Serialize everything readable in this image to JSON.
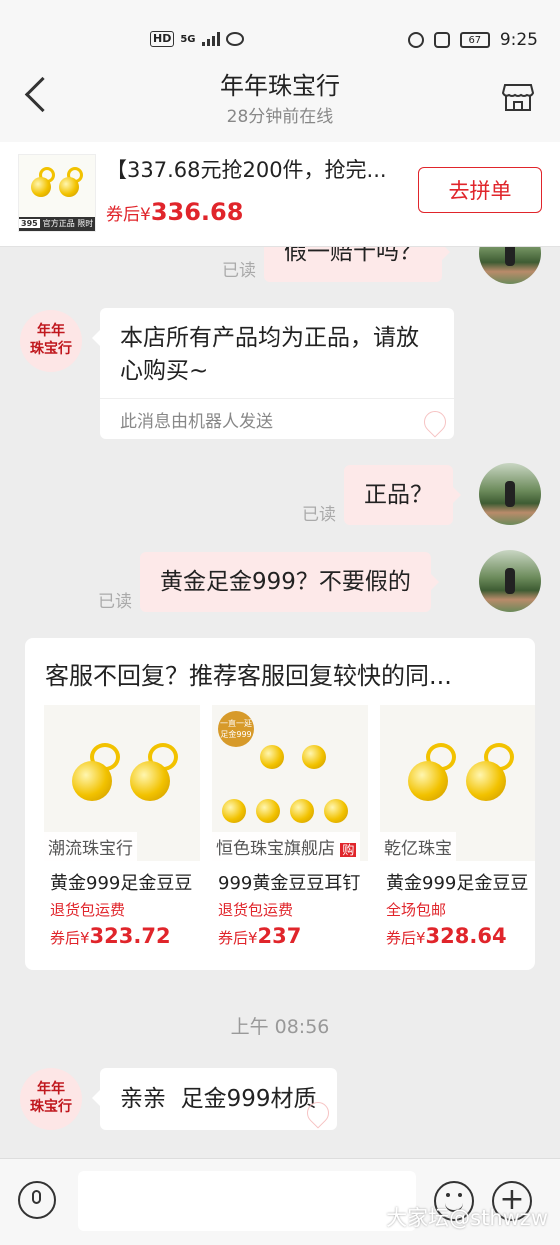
{
  "status_bar": {
    "hd": "HD",
    "network": "5G",
    "battery": "67",
    "time": "9:25"
  },
  "header": {
    "title": "年年珠宝行",
    "subtitle": "28分钟前在线"
  },
  "product": {
    "name": "【337.68元抢200件，抢完...",
    "price_prefix": "券后¥",
    "price": "336.68",
    "thumb_tag_num": "395",
    "thumb_tag_text": "官方正品 限时优惠",
    "button": "去拼单"
  },
  "messages": [
    {
      "side": "right",
      "text": "假一赔十吗？",
      "read": "已读"
    },
    {
      "side": "left",
      "text": "本店所有产品均为正品，请放心购买~",
      "note": "此消息由机器人发送"
    },
    {
      "side": "right",
      "text": "正品？",
      "read": "已读"
    },
    {
      "side": "right",
      "text": "黄金足金999？不要假的",
      "read": "已读"
    }
  ],
  "shop_avatar": {
    "line1": "年年",
    "line2": "珠宝行"
  },
  "recommendation": {
    "title": "客服不回复？推荐客服回复较快的同...",
    "items": [
      {
        "shop": "潮流珠宝行",
        "name": "黄金999足金豆豆",
        "tag": "退货包运费",
        "price_prefix": "券后¥",
        "price": "323.72"
      },
      {
        "shop": "恒色珠宝旗舰店",
        "shop_badge": "购",
        "name": "999黄金豆豆耳钉",
        "tag": "退货包运费",
        "price_prefix": "券后¥",
        "price": "237",
        "badge_text": "一直一延 足金999"
      },
      {
        "shop": "乾亿珠宝",
        "name": "黄金999足金豆豆",
        "tag": "全场包邮",
        "price_prefix": "券后¥",
        "price": "328.64"
      }
    ]
  },
  "timestamp": "上午 08:56",
  "last_message": {
    "text": "亲亲  足金999材质"
  },
  "watermark": "大家坛@sthwzw"
}
